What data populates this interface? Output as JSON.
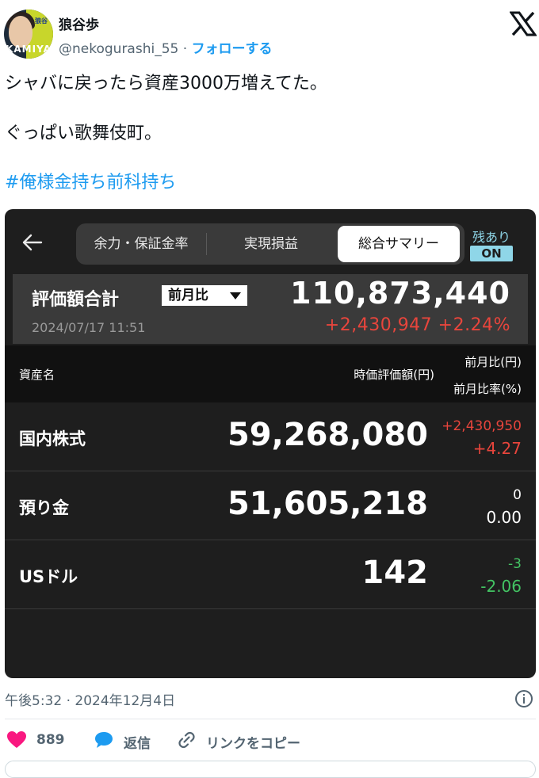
{
  "header": {
    "display_name": "狼谷歩",
    "handle": "@nekogurashi_55",
    "separator": "·",
    "follow_label": "フォローする",
    "avatar_logo": "KAMIYA",
    "avatar_seal": "狼谷"
  },
  "tweet": {
    "line1": "シャバに戻ったら資産3000万増えてた。",
    "line2": "ぐっぱい歌舞伎町。",
    "hashtags": "#俺様金持ち前科持ち"
  },
  "card": {
    "tabs": [
      {
        "label": "余力・保証金率",
        "active": false
      },
      {
        "label": "実現損益",
        "active": false
      },
      {
        "label": "総合サマリー",
        "active": true
      }
    ],
    "residual": {
      "label": "残あり",
      "toggle": "ON"
    },
    "summary": {
      "label": "評価額合計",
      "period": "前月比",
      "total": "110,873,440",
      "date": "2024/07/17 11:51",
      "change": "+2,430,947 +2.24%"
    },
    "table": {
      "col_name": "資産名",
      "col_value": "時価評価額(円)",
      "col_diff": "前月比(円)",
      "col_rate": "前月比率(%)",
      "rows": [
        {
          "name": "国内株式",
          "value": "59,268,080",
          "diff": "+2,430,950",
          "rate": "+4.27",
          "trend": "up"
        },
        {
          "name": "預り金",
          "value": "51,605,218",
          "diff": "0",
          "rate": "0.00",
          "trend": "flat"
        },
        {
          "name": "USドル",
          "value": "142",
          "diff": "-3",
          "rate": "-2.06",
          "trend": "down"
        }
      ]
    }
  },
  "footer": {
    "timestamp": "午後5:32 · 2024年12月4日",
    "likes": "889",
    "reply_label": "返信",
    "copy_link_label": "リンクをコピー"
  },
  "colors": {
    "accent": "#1d9bf0",
    "positive": "#e8453c",
    "negative": "#43c463",
    "like": "#f91880",
    "toggle": "#8fd6e8"
  }
}
